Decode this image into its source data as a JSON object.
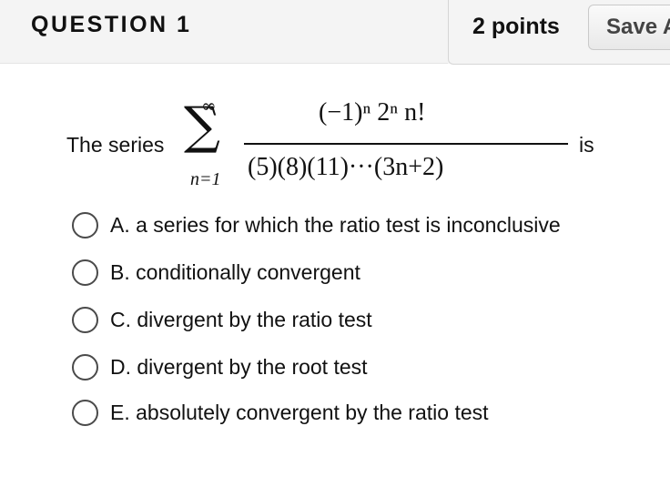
{
  "header": {
    "title": "QUESTION 1",
    "points": "2 points",
    "save_label": "Save A"
  },
  "question": {
    "prefix": "The series",
    "suffix": "is",
    "sum_symbol": "∑",
    "sum_upper": "∞",
    "sum_lower": "n=1",
    "numerator": "(−1)ⁿ 2ⁿ n!",
    "denominator": "(5)(8)(11)···(3n+2)"
  },
  "options": [
    {
      "label": "A. a series for which the ratio test is inconclusive"
    },
    {
      "label": "B. conditionally convergent"
    },
    {
      "label": "C. divergent by the ratio test"
    },
    {
      "label": "D. divergent by the root test"
    },
    {
      "label": "E. absolutely convergent by the ratio test"
    }
  ]
}
